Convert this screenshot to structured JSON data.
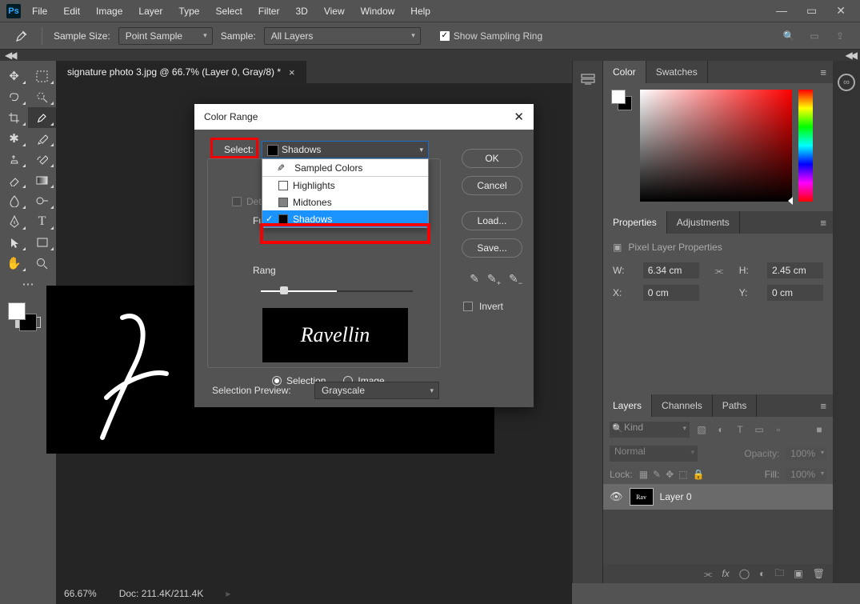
{
  "menu": {
    "items": [
      "File",
      "Edit",
      "Image",
      "Layer",
      "Type",
      "Select",
      "Filter",
      "3D",
      "View",
      "Window",
      "Help"
    ]
  },
  "optionsbar": {
    "sample_size_label": "Sample Size:",
    "sample_size_value": "Point Sample",
    "sample_label": "Sample:",
    "sample_value": "All Layers",
    "ring_label": "Show Sampling Ring",
    "ring_checked": "✓"
  },
  "doc": {
    "tab_title": "signature photo 3.jpg @ 66.7% (Layer 0, Gray/8) *",
    "zoom": "66.67%",
    "docsize": "Doc: 211.4K/211.4K",
    "signature_text": "Ravellin"
  },
  "dialog": {
    "title": "Color Range",
    "select_label": "Select:",
    "select_value": "Shadows",
    "options": {
      "sampled": "Sampled Colors",
      "hl": "Highlights",
      "mid": "Midtones",
      "sh": "Shadows"
    },
    "detect_label": "Detect F",
    "fuzziness_label": "Fuzzi",
    "range_label": "Rang",
    "radio_selection": "Selection",
    "radio_image": "Image",
    "sel_preview_label": "Selection Preview:",
    "sel_preview_value": "Grayscale",
    "buttons": {
      "ok": "OK",
      "cancel": "Cancel",
      "load": "Load...",
      "save": "Save..."
    },
    "invert_label": "Invert"
  },
  "panels": {
    "color_tab": "Color",
    "swatches_tab": "Swatches",
    "props_tab": "Properties",
    "adjust_tab": "Adjustments",
    "props_title": "Pixel Layer Properties",
    "w_label": "W:",
    "w_val": "6.34 cm",
    "h_label": "H:",
    "h_val": "2.45 cm",
    "x_label": "X:",
    "x_val": "0 cm",
    "y_label": "Y:",
    "y_val": "0 cm",
    "layers_tab": "Layers",
    "channels_tab": "Channels",
    "paths_tab": "Paths",
    "kind": "Kind",
    "blend": "Normal",
    "opacity_label": "Opacity:",
    "opacity_val": "100%",
    "lock_label": "Lock:",
    "fill_label": "Fill:",
    "fill_val": "100%",
    "layer_name": "Layer 0"
  }
}
